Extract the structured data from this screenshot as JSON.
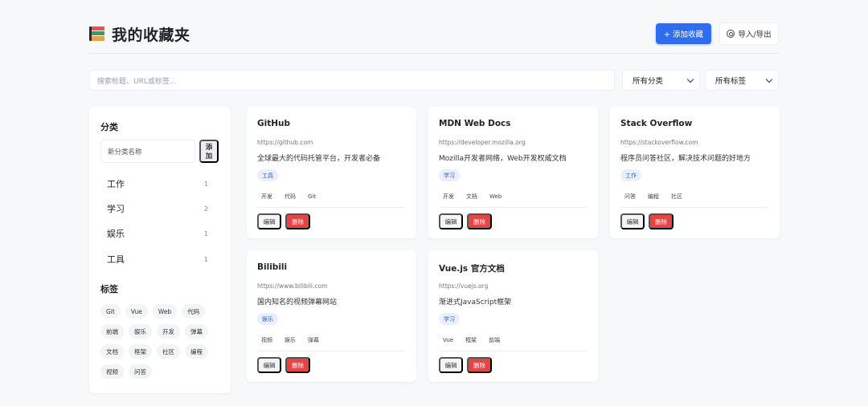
{
  "header": {
    "title": "我的收藏夹",
    "add_button": "+ 添加收藏",
    "import_export": "导入/导出"
  },
  "filters": {
    "search_placeholder": "搜索标题、URL或标签...",
    "category_select": "所有分类",
    "tag_select": "所有标签"
  },
  "sidebar": {
    "categories_heading": "分类",
    "new_category_placeholder": "新分类名称",
    "add_category_button": "添加",
    "categories": [
      {
        "name": "工作",
        "count": "1"
      },
      {
        "name": "学习",
        "count": "2"
      },
      {
        "name": "娱乐",
        "count": "1"
      },
      {
        "name": "工具",
        "count": "1"
      }
    ],
    "tags_heading": "标签",
    "tags": [
      "Git",
      "Vue",
      "Web",
      "代码",
      "前端",
      "娱乐",
      "开发",
      "弹幕",
      "文档",
      "框架",
      "社区",
      "编程",
      "视频",
      "问答"
    ]
  },
  "bookmarks": [
    {
      "title": "GitHub",
      "url": "https://github.com",
      "desc": "全球最大的代码托管平台，开发者必备",
      "category": "工具",
      "tags": [
        "开发",
        "代码",
        "Git"
      ]
    },
    {
      "title": "MDN Web Docs",
      "url": "https://developer.mozilla.org",
      "desc": "Mozilla开发者网络，Web开发权威文档",
      "category": "学习",
      "tags": [
        "开发",
        "文档",
        "Web"
      ]
    },
    {
      "title": "Stack Overflow",
      "url": "https://stackoverflow.com",
      "desc": "程序员问答社区，解决技术问题的好地方",
      "category": "工作",
      "tags": [
        "问答",
        "编程",
        "社区"
      ]
    },
    {
      "title": "Bilibili",
      "url": "https://www.bilibili.com",
      "desc": "国内知名的视频弹幕网站",
      "category": "娱乐",
      "tags": [
        "视频",
        "娱乐",
        "弹幕"
      ]
    },
    {
      "title": "Vue.js 官方文档",
      "url": "https://vuejs.org",
      "desc": "渐进式JavaScript框架",
      "category": "学习",
      "tags": [
        "Vue",
        "框架",
        "前端"
      ]
    }
  ],
  "card_actions": {
    "edit": "编辑",
    "delete": "删除"
  },
  "colors": {
    "primary": "#2f6df0",
    "danger": "#e64545",
    "badge_bg": "#e9effc"
  }
}
